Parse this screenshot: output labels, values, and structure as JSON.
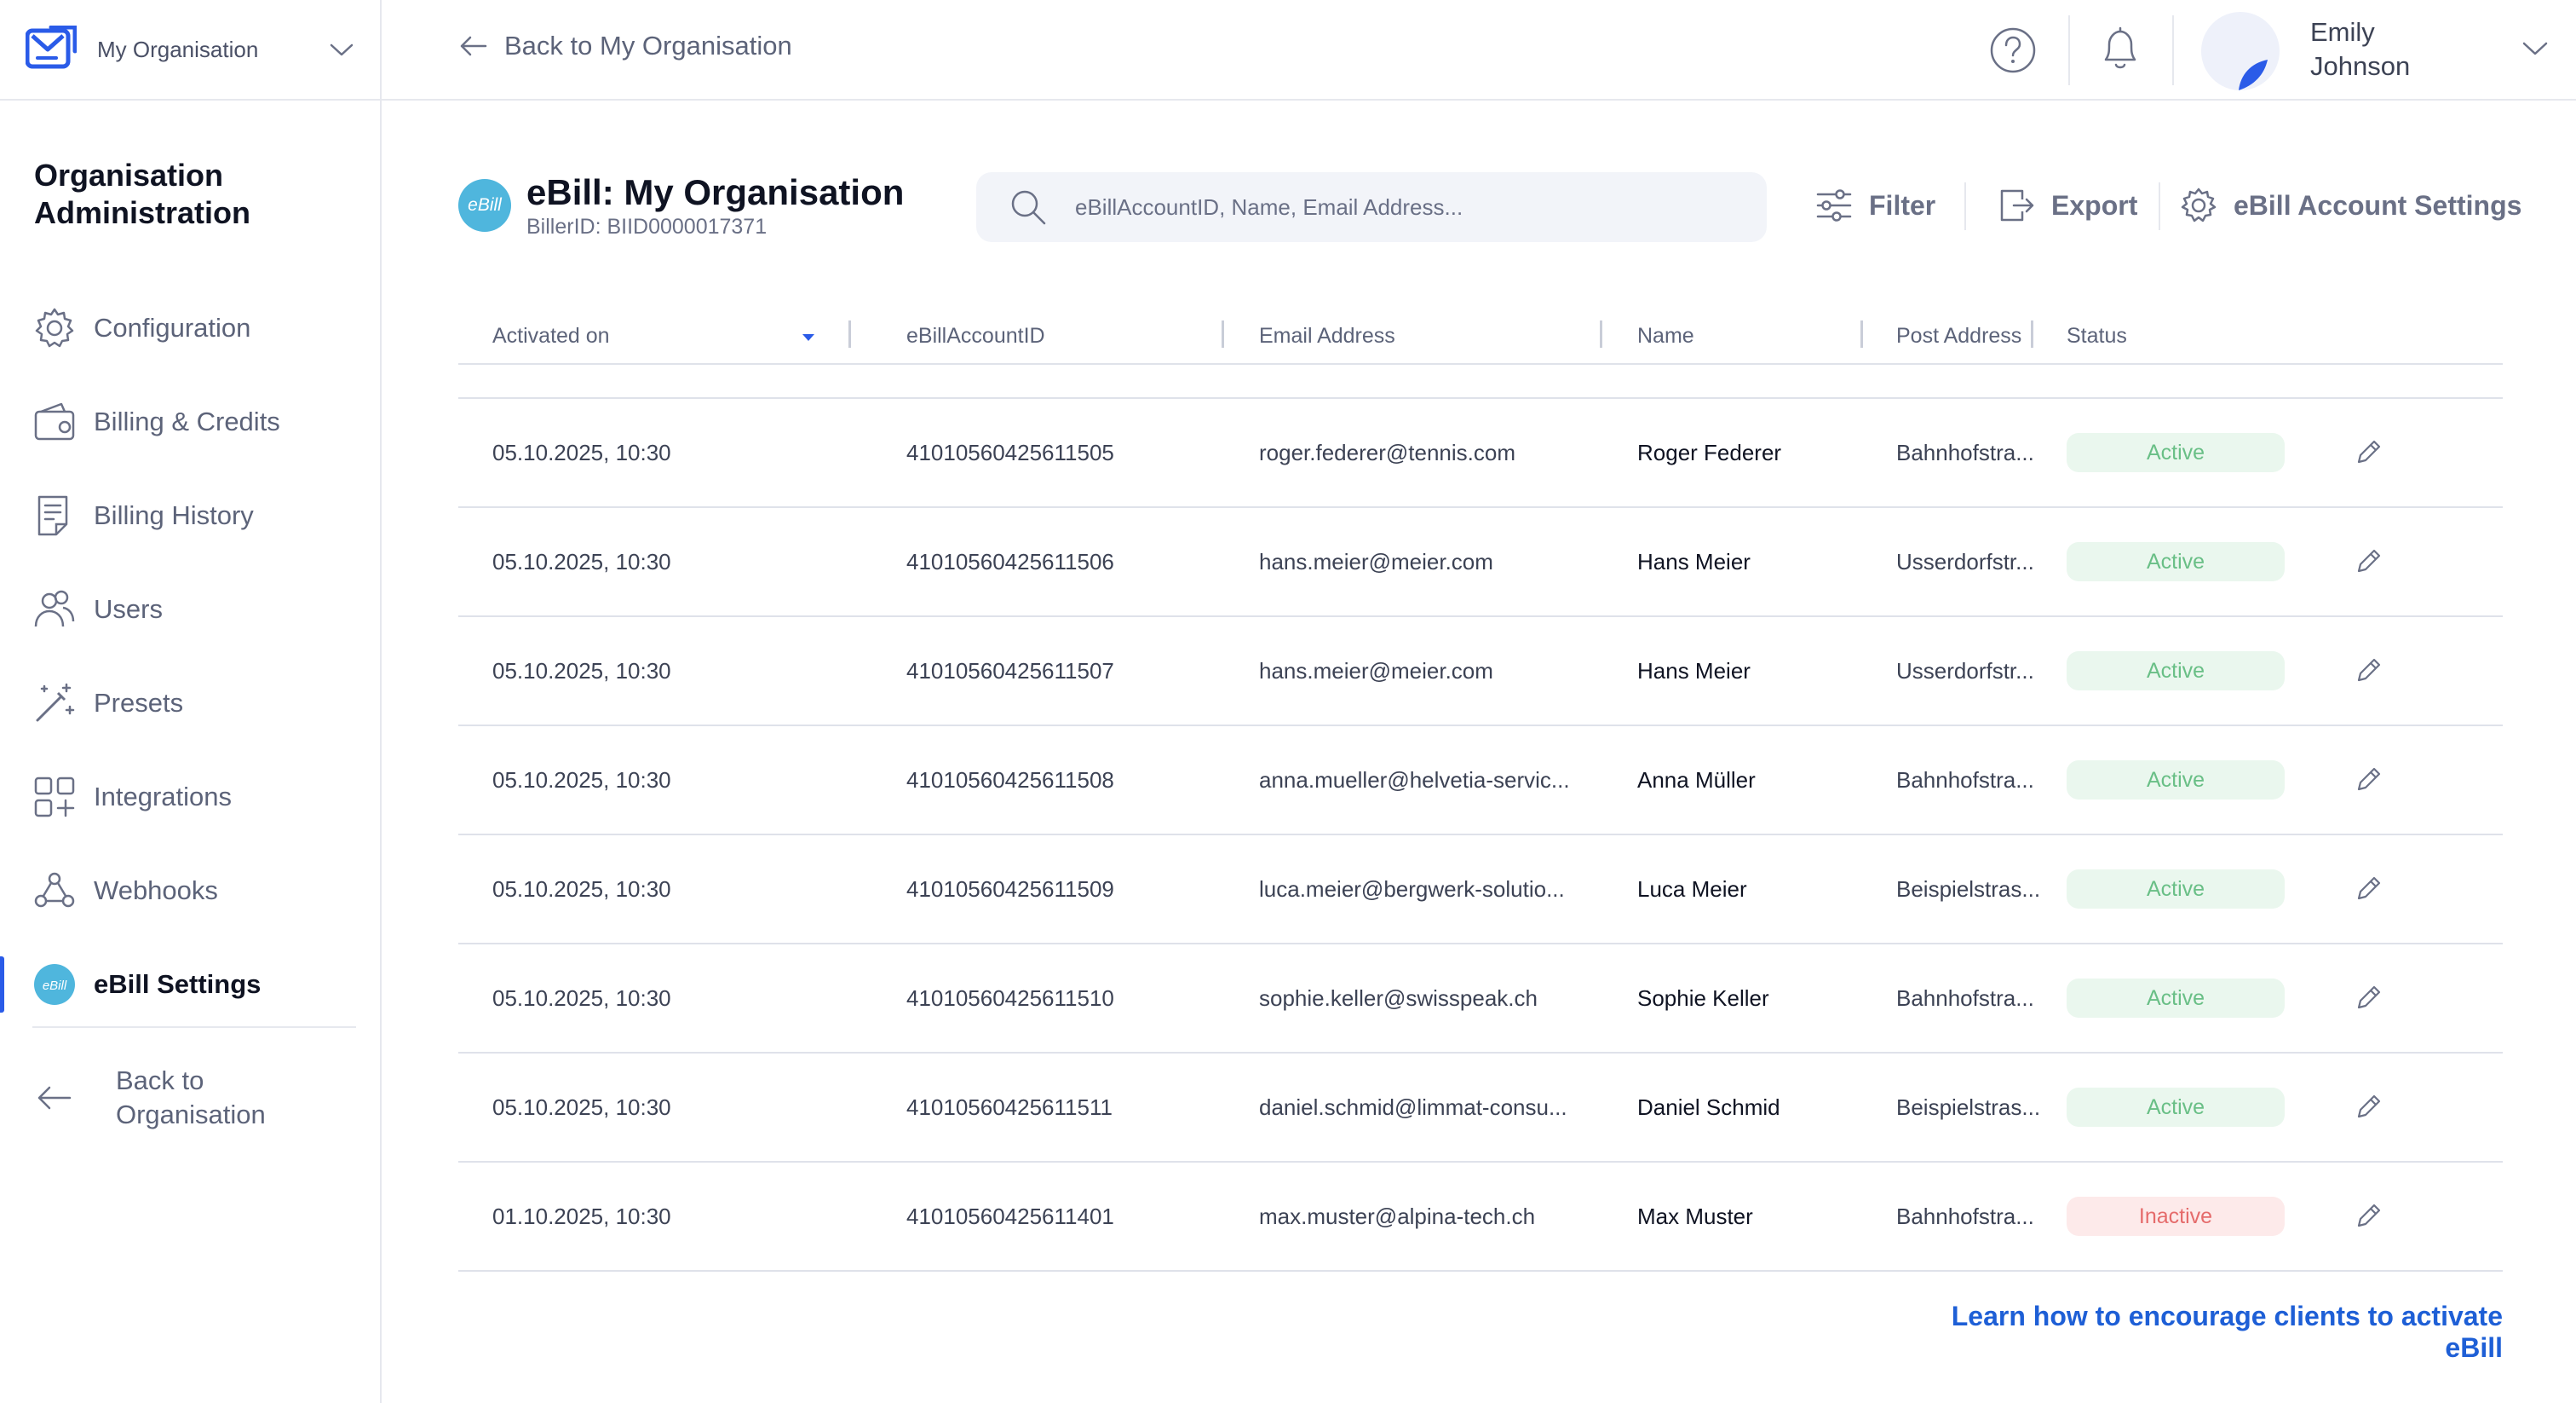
{
  "sidebar": {
    "org_switcher": {
      "name": "My Organisation"
    },
    "title": "Organisation Administration",
    "items": [
      {
        "label": "Configuration",
        "icon": "gear-icon"
      },
      {
        "label": "Billing & Credits",
        "icon": "wallet-icon"
      },
      {
        "label": "Billing History",
        "icon": "document-icon"
      },
      {
        "label": "Users",
        "icon": "users-icon"
      },
      {
        "label": "Presets",
        "icon": "magic-wand-icon"
      },
      {
        "label": "Integrations",
        "icon": "grid-plus-icon"
      },
      {
        "label": "Webhooks",
        "icon": "webhook-icon"
      },
      {
        "label": "eBill Settings",
        "icon": "ebill-icon",
        "active": true
      }
    ],
    "back": {
      "label": "Back to Organisation"
    }
  },
  "topbar": {
    "back_label": "Back to My Organisation",
    "user": {
      "first": "Emily",
      "last": "Johnson"
    }
  },
  "header": {
    "badge": "eBill",
    "title": "eBill: My Organisation",
    "biller_id": "BillerID: BIID0000017371",
    "search_placeholder": "eBillAccountID, Name, Email Address...",
    "filter_label": "Filter",
    "export_label": "Export",
    "settings_label": "eBill Account Settings"
  },
  "table": {
    "columns": [
      "Activated on",
      "eBillAccountID",
      "Email Address",
      "Name",
      "Post Address",
      "Status"
    ],
    "sorted_column": "Activated on",
    "rows": [
      {
        "date": "05.10.2025, 10:30",
        "id": "41010560425611505",
        "email": "roger.federer@tennis.com",
        "name": "Roger Federer",
        "post": "Bahnhofstra...",
        "status": "Active"
      },
      {
        "date": "05.10.2025, 10:30",
        "id": "41010560425611506",
        "email": "hans.meier@meier.com",
        "name": "Hans Meier",
        "post": "Usserdorfstr...",
        "status": "Active"
      },
      {
        "date": "05.10.2025, 10:30",
        "id": "41010560425611507",
        "email": "hans.meier@meier.com",
        "name": "Hans Meier",
        "post": "Usserdorfstr...",
        "status": "Active"
      },
      {
        "date": "05.10.2025, 10:30",
        "id": "41010560425611508",
        "email": "anna.mueller@helvetia-servic...",
        "name": "Anna Müller",
        "post": "Bahnhofstra...",
        "status": "Active"
      },
      {
        "date": "05.10.2025, 10:30",
        "id": "41010560425611509",
        "email": "luca.meier@bergwerk-solutio...",
        "name": "Luca Meier",
        "post": "Beispielstras...",
        "status": "Active"
      },
      {
        "date": "05.10.2025, 10:30",
        "id": "41010560425611510",
        "email": "sophie.keller@swisspeak.ch",
        "name": "Sophie Keller",
        "post": "Bahnhofstra...",
        "status": "Active"
      },
      {
        "date": "05.10.2025, 10:30",
        "id": "41010560425611511",
        "email": "daniel.schmid@limmat-consu...",
        "name": "Daniel Schmid",
        "post": "Beispielstras...",
        "status": "Active"
      },
      {
        "date": "01.10.2025, 10:30",
        "id": "41010560425611401",
        "email": "max.muster@alpina-tech.ch",
        "name": "Max Muster",
        "post": "Bahnhofstra...",
        "status": "Inactive"
      }
    ]
  },
  "footer": {
    "learn_link": "Learn how to encourage clients to activate eBill"
  },
  "colors": {
    "accent": "#2a5be8",
    "link": "#1e5fd6",
    "ebill_badge": "#4fb6dd",
    "status_active_bg": "#eaf7ee",
    "status_active_text": "#69bf86",
    "status_inactive_bg": "#fdeaea",
    "status_inactive_text": "#e56b6b"
  }
}
